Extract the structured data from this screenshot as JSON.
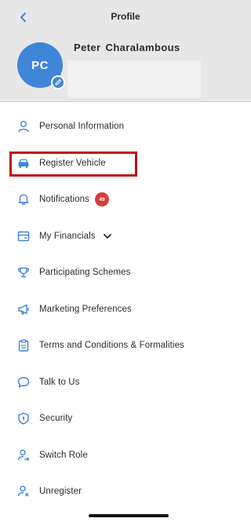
{
  "header": {
    "title": "Profile",
    "back_icon": "chevron-left-icon"
  },
  "profile": {
    "initials": "PC",
    "name": "Peter  Charalambous",
    "avatar_color": "#3f86d9",
    "edit_icon": "pencil-icon"
  },
  "menu": {
    "items": [
      {
        "label": "Personal Information",
        "icon": "person-icon"
      },
      {
        "label": "Register Vehicle",
        "icon": "car-icon"
      },
      {
        "label": "Notifications",
        "icon": "bell-icon",
        "badge": "49"
      },
      {
        "label": "My Financials",
        "icon": "wallet-icon",
        "expand_icon": "chevron-down-icon"
      },
      {
        "label": "Participating Schemes",
        "icon": "trophy-icon",
        "highlighted": true
      },
      {
        "label": "Marketing Preferences",
        "icon": "megaphone-icon"
      },
      {
        "label": "Terms and Conditions & Formalities",
        "icon": "clipboard-icon"
      },
      {
        "label": "Talk to Us",
        "icon": "chat-bubble-icon"
      },
      {
        "label": "Security",
        "icon": "shield-icon"
      },
      {
        "label": "Switch Role",
        "icon": "switch-user-icon"
      },
      {
        "label": "Unregister",
        "icon": "remove-user-icon"
      }
    ]
  },
  "colors": {
    "accent": "#3f86d9",
    "badge": "#d83a3a",
    "highlight_border": "#c00f14",
    "header_bg": "#e7e7e7"
  }
}
